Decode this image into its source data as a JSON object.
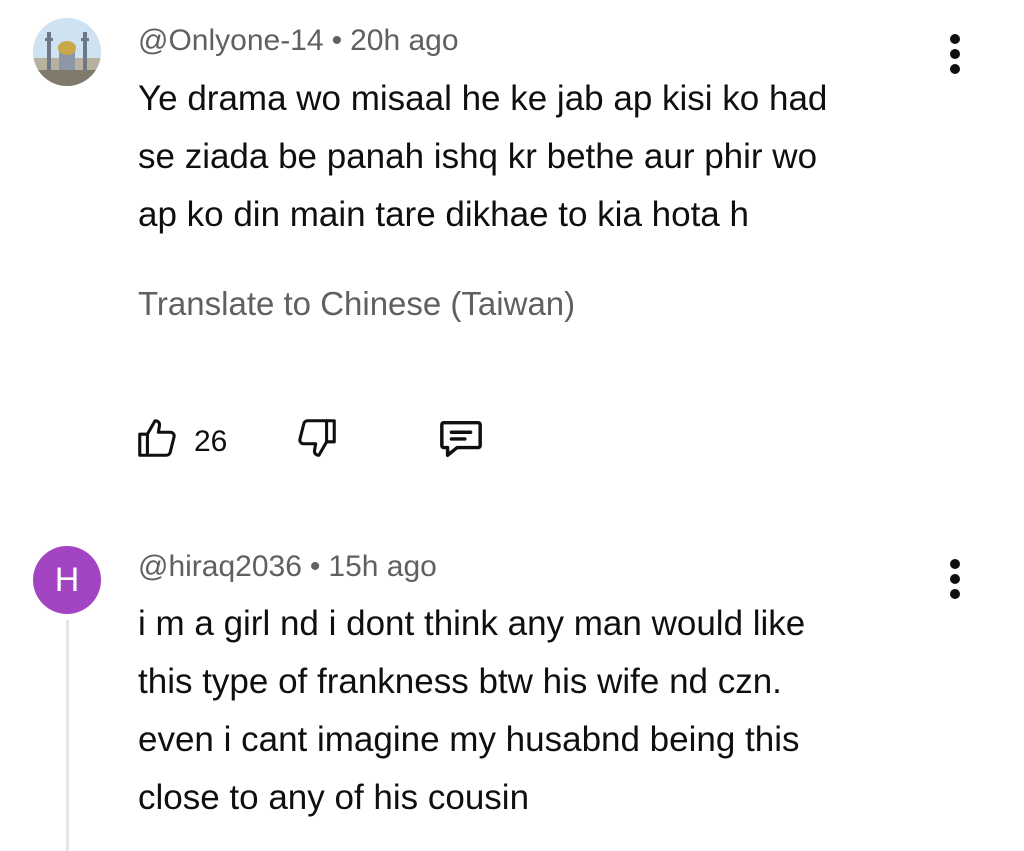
{
  "comments": [
    {
      "handle": "@Onlyone-14",
      "time": "20h ago",
      "avatar": "mosque-photo-avatar",
      "text_lines": [
        "Ye drama wo misaal he ke jab ap kisi ko had",
        "se ziada be panah ishq kr bethe aur phir wo",
        "ap ko din main tare dikhae to kia hota h"
      ],
      "translate": "Translate to Chinese (Taiwan)",
      "likes": "26"
    },
    {
      "handle": "@hiraq2036",
      "time": "15h ago",
      "avatar_letter": "H",
      "avatar_color": "#a345c2",
      "text_lines": [
        "i m a girl nd i dont think any man would like",
        "this type of frankness btw his wife nd czn.",
        "even i cant imagine my husabnd being this",
        "close to any of his cousin"
      ]
    }
  ],
  "separator": "•"
}
